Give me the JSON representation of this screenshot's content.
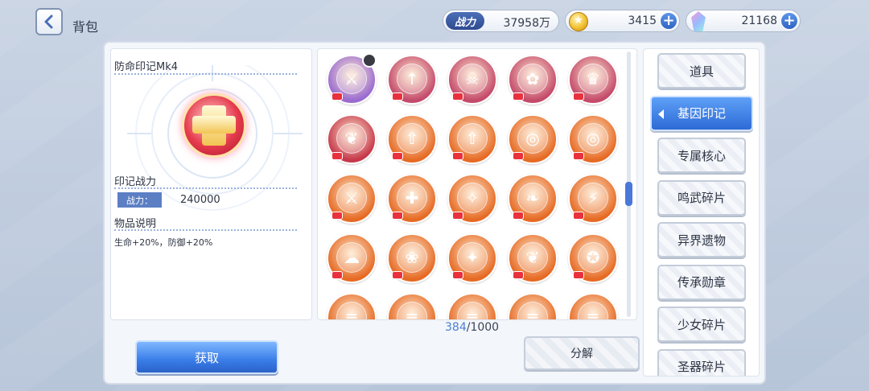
{
  "header": {
    "title": "背包",
    "power_label": "战力",
    "power_value": "37958万",
    "coins": "3415",
    "gems": "21168"
  },
  "detail": {
    "name": "防命印记Mk4",
    "power_section": "印记战力",
    "power_tag": "战力：",
    "power_value": "240000",
    "desc_title": "物品说明",
    "desc": "生命+20%，防御+20%"
  },
  "inventory": {
    "current": "384",
    "total": "/1000",
    "emblems": [
      {
        "icon": "shield-hand",
        "color": "#9a6bd0",
        "glyph": "⚔"
      },
      {
        "icon": "arrows",
        "color": "#c44a6a",
        "glyph": "↑"
      },
      {
        "icon": "skull",
        "color": "#c44a6a",
        "glyph": "☠"
      },
      {
        "icon": "frog",
        "color": "#c44a6a",
        "glyph": "✿"
      },
      {
        "icon": "crest",
        "color": "#c44a6a",
        "glyph": "♛"
      },
      {
        "icon": "leaves",
        "color": "#c6384a",
        "glyph": "❦"
      },
      {
        "icon": "up-arrows",
        "color": "#e66a24",
        "glyph": "⇧"
      },
      {
        "icon": "up-arrows",
        "color": "#e66a24",
        "glyph": "⇧"
      },
      {
        "icon": "swirl",
        "color": "#e66a24",
        "glyph": "◎"
      },
      {
        "icon": "swirl",
        "color": "#e66a24",
        "glyph": "◎"
      },
      {
        "icon": "sword",
        "color": "#e66a24",
        "glyph": "⚔"
      },
      {
        "icon": "cross",
        "color": "#e66a24",
        "glyph": "✚"
      },
      {
        "icon": "shield-break",
        "color": "#e66a24",
        "glyph": "✧"
      },
      {
        "icon": "leaf",
        "color": "#e66a24",
        "glyph": "❧"
      },
      {
        "icon": "lightning",
        "color": "#e66a24",
        "glyph": "⚡"
      },
      {
        "icon": "ghost",
        "color": "#e66a24",
        "glyph": "☁"
      },
      {
        "icon": "wing",
        "color": "#e66a24",
        "glyph": "❀"
      },
      {
        "icon": "bat",
        "color": "#e66a24",
        "glyph": "✦"
      },
      {
        "icon": "feather",
        "color": "#e66a24",
        "glyph": "❦"
      },
      {
        "icon": "bird",
        "color": "#e66a24",
        "glyph": "✪"
      },
      {
        "icon": "stripes",
        "color": "#e66a24",
        "glyph": "≡"
      },
      {
        "icon": "stripes",
        "color": "#e66a24",
        "glyph": "≡"
      },
      {
        "icon": "stripes",
        "color": "#e66a24",
        "glyph": "≡"
      },
      {
        "icon": "stripes",
        "color": "#e66a24",
        "glyph": "≡"
      },
      {
        "icon": "stripes",
        "color": "#e66a24",
        "glyph": "≡"
      }
    ]
  },
  "actions": {
    "get": "获取",
    "decompose": "分解"
  },
  "tabs": [
    {
      "label": "道具"
    },
    {
      "label": "基因印记"
    },
    {
      "label": "专属核心"
    },
    {
      "label": "鸣武碎片"
    },
    {
      "label": "异界遗物"
    },
    {
      "label": "传承勋章"
    },
    {
      "label": "少女碎片"
    },
    {
      "label": "圣器碎片"
    }
  ],
  "active_tab": "基因印记"
}
